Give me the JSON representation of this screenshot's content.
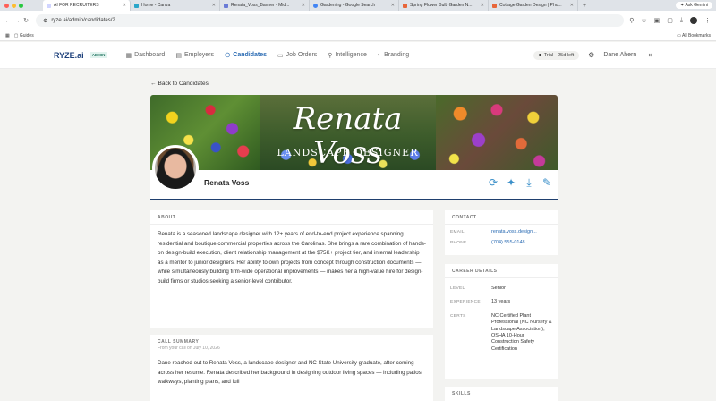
{
  "browser": {
    "tabs": [
      {
        "title": "AI FOR RECRUITERS",
        "active": true,
        "color": "#d0d4ff"
      },
      {
        "title": "Home - Canva",
        "active": false,
        "color": "#2aa6c9"
      },
      {
        "title": "Renata_Voss_Banner - Mid...",
        "active": false,
        "color": "#6b7bd6"
      },
      {
        "title": "Gardening - Google Search",
        "active": false,
        "color": "#4285f4"
      },
      {
        "title": "Spring Flower Bulb Garden N...",
        "active": false,
        "color": "#e8663a"
      },
      {
        "title": "Cottage Garden Design | Pho...",
        "active": false,
        "color": "#e8663a"
      }
    ],
    "new_tab": "+",
    "gemini": "Ask Gemini",
    "url": "ryze.ai/admin/candidates/2",
    "bookmark_guides": "Guides",
    "bookmark_all": "All Bookmarks"
  },
  "app": {
    "logo": "RYZE.ai",
    "badge": "ADMIN",
    "nav": [
      {
        "label": "Dashboard",
        "icon": "▦",
        "active": false
      },
      {
        "label": "Employers",
        "icon": "▤",
        "active": false
      },
      {
        "label": "Candidates",
        "icon": "⚇",
        "active": true
      },
      {
        "label": "Job Orders",
        "icon": "▭",
        "active": false
      },
      {
        "label": "Intelligence",
        "icon": "⚲",
        "active": false
      },
      {
        "label": "Branding",
        "icon": "◐",
        "active": false
      }
    ],
    "trial": "Trial · 25d left",
    "user": "Dane Ahern"
  },
  "page": {
    "back": "Back to Candidates",
    "banner_title": "Renata Voss",
    "banner_subtitle": "LANDSCAPE DESIGNER",
    "name": "Renata Voss"
  },
  "about": {
    "title": "ABOUT",
    "text": "Renata is a seasoned landscape designer with 12+ years of end-to-end project experience spanning residential and boutique commercial properties across the Carolinas. She brings a rare combination of hands-on design-build execution, client relationship management at the $75K+ project tier, and internal leadership as a mentor to junior designers. Her ability to own projects from concept through construction documents — while simultaneously building firm-wide operational improvements — makes her a high-value hire for design-build firms or studios seeking a senior-level contributor."
  },
  "call": {
    "title": "CALL SUMMARY",
    "subtitle": "From your call on July 10, 2026",
    "text": "Dane reached out to Renata Voss, a landscape designer and NC State University graduate, after coming across her resume. Renata described her background in designing outdoor living spaces — including patios, walkways, planting plans, and full"
  },
  "contact": {
    "title": "CONTACT",
    "email_label": "EMAIL",
    "email": "renata.voss.design...",
    "phone_label": "PHONE",
    "phone": "(704) 555-0148"
  },
  "career": {
    "title": "CAREER DETAILS",
    "level_label": "LEVEL",
    "level": "Senior",
    "experience_label": "EXPERIENCE",
    "experience": "13 years",
    "certs_label": "CERTS",
    "certs": "NC Certified Plant Professional (NC Nursery & Landscape Association), OSHA 10-Hour Construction Safety Certification"
  },
  "skills": {
    "title": "SKILLS"
  }
}
